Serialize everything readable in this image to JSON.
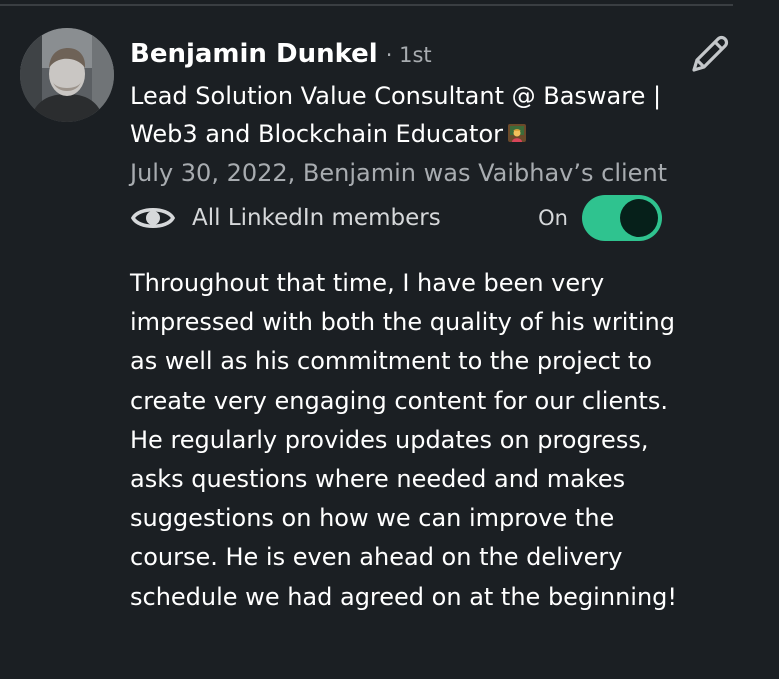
{
  "recommendation": {
    "author_name": "Benjamin Dunkel",
    "connection_degree": "· 1st",
    "headline": "Lead Solution Value Consultant @ Basware | Web3 and Blockchain Educator",
    "meta": "July 30, 2022, Benjamin was Vaibhav’s client",
    "visibility": {
      "label": "All LinkedIn members",
      "toggle_state": "On",
      "toggle_on": true,
      "accent_color": "#2fc38f"
    },
    "body": "Throughout that time, I have been very impressed with both the quality of his writing as well as his commitment to the project to create very engaging content for our clients. He regularly provides updates on progress, asks questions where needed and makes suggestions on how we can improve the course. He is even ahead on the delivery schedule we had agreed on at the beginning!"
  },
  "icons": {
    "avatar": "profile-photo",
    "edit": "pencil-icon",
    "visibility": "eye-icon",
    "headline_emoji": "teacher-emoji-icon"
  }
}
